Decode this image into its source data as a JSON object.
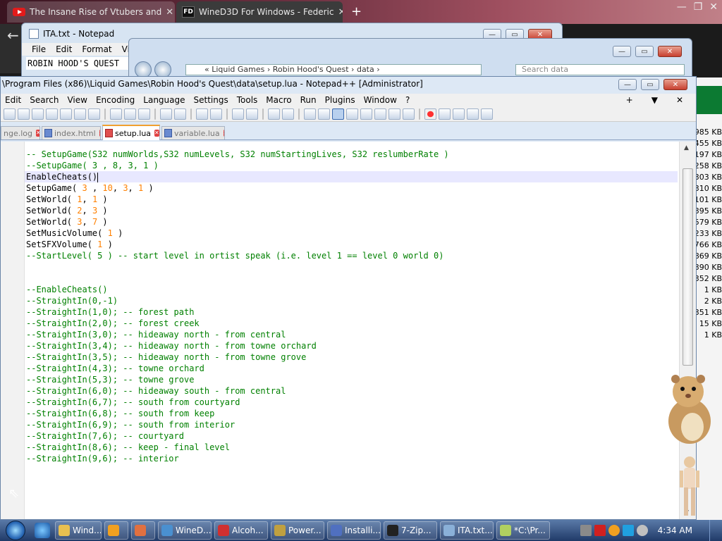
{
  "browser": {
    "tabs": [
      {
        "title": "The Insane Rise of Vtubers and"
      },
      {
        "title": "WineD3D For Windows - Federic"
      }
    ],
    "newtab": "+",
    "fd_label": "FD"
  },
  "notepad": {
    "title": "ITA.txt - Notepad",
    "menu": [
      "File",
      "Edit",
      "Format",
      "View"
    ],
    "content": "ROBIN HOOD'S QUEST"
  },
  "explorer": {
    "address": "« Liquid Games › Robin Hood's Quest › data ›",
    "search_placeholder": "Search data"
  },
  "file_sizes": [
    "985 KB",
    "455 KB",
    "197 KB",
    "258 KB",
    "303 KB",
    "310 KB",
    "101 KB",
    "395 KB",
    "579 KB",
    "233 KB",
    "766 KB",
    "869 KB",
    "390 KB",
    "352 KB",
    "1 KB",
    "2 KB",
    "351 KB",
    "15 KB",
    "1 KB"
  ],
  "npp": {
    "title": "\\Program Files (x86)\\Liquid Games\\Robin Hood's Quest\\data\\setup.lua - Notepad++ [Administrator]",
    "menu": [
      "Edit",
      "Search",
      "View",
      "Encoding",
      "Language",
      "Settings",
      "Tools",
      "Macro",
      "Run",
      "Plugins",
      "Window",
      "?"
    ],
    "menu_right": [
      "+",
      "▼",
      "✕"
    ],
    "tabs": [
      {
        "label": "nge.log",
        "active": false
      },
      {
        "label": "index.html",
        "active": false
      },
      {
        "label": "setup.lua",
        "active": true
      },
      {
        "label": "variable.lua",
        "active": false
      }
    ],
    "code_lines": [
      "-- SetupGame(S32 numWorlds,S32 numLevels, S32 numStartingLives, S32 reslumberRate )",
      "--SetupGame( 3 , 8, 3, 1 )",
      "EnableCheats()",
      "SetupGame( 3 , 10, 3, 1 )",
      "SetWorld( 1, 1 )",
      "SetWorld( 2, 3 )",
      "SetWorld( 3, 7 )",
      "SetMusicVolume( 1 )",
      "SetSFXVolume( 1 )",
      "--StartLevel( 5 ) -- start level in ortist speak (i.e. level 1 == level 0 world 0)",
      "",
      "",
      "--EnableCheats()",
      "--StraightIn(0,-1)",
      "--StraightIn(1,0); -- forest path",
      "--StraightIn(2,0); -- forest creek",
      "--StraightIn(3,0); -- hideaway north - from central",
      "--StraightIn(3,4); -- hideaway north - from towne orchard",
      "--StraightIn(3,5); -- hideaway north - from towne grove",
      "--StraightIn(4,3); -- towne orchard",
      "--StraightIn(5,3); -- towne grove",
      "--StraightIn(6,0); -- hideaway south - from central",
      "--StraightIn(6,7); -- south from courtyard",
      "--StraightIn(6,8); -- south from keep",
      "--StraightIn(6,9); -- south from interior",
      "--StraightIn(7,6); -- courtyard",
      "--StraightIn(8,6); -- keep - final level",
      "--StraightIn(9,6); -- interior"
    ],
    "current_line": 2
  },
  "taskbar": {
    "tasks": [
      {
        "label": "Wind...",
        "color": "#e8c050"
      },
      {
        "label": "",
        "color": "#f0a020"
      },
      {
        "label": "",
        "color": "#e07040"
      },
      {
        "label": "WineD...",
        "color": "#4a90d0"
      },
      {
        "label": "Alcoh...",
        "color": "#d03030"
      },
      {
        "label": "Power...",
        "color": "#c0a040"
      },
      {
        "label": "Installi...",
        "color": "#5070c0"
      },
      {
        "label": "7-Zip...",
        "color": "#222222"
      },
      {
        "label": "ITA.txt...",
        "color": "#8ab0d8"
      },
      {
        "label": "*C:\\Pr...",
        "color": "#b0d060"
      }
    ],
    "clock": "4:34 AM"
  }
}
